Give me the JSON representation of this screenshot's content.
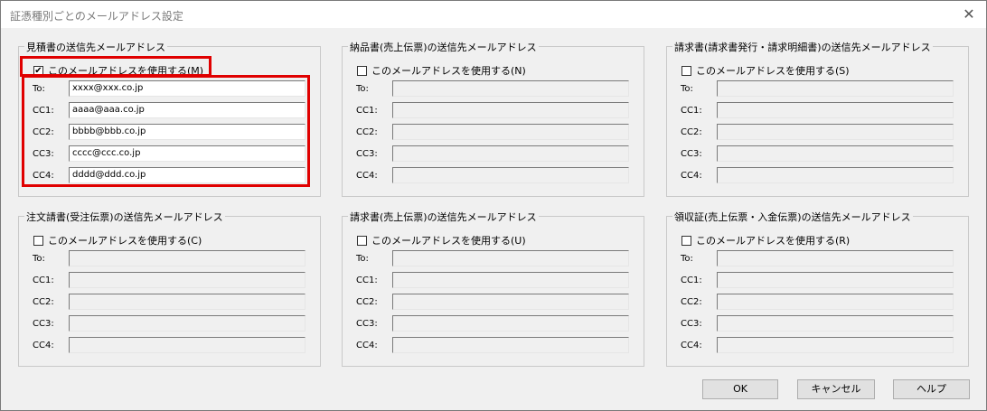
{
  "window": {
    "title": "証憑種別ごとのメールアドレス設定",
    "close_glyph": "✕"
  },
  "labels": {
    "to": "To:",
    "cc1": "CC1:",
    "cc2": "CC2:",
    "cc3": "CC3:",
    "cc4": "CC4:"
  },
  "groups": [
    {
      "title": "見積書の送信先メールアドレス",
      "checkbox_label": "このメールアドレスを使用する(M)",
      "checked": true,
      "to": "xxxx@xxx.co.jp",
      "cc1": "aaaa@aaa.co.jp",
      "cc2": "bbbb@bbb.co.jp",
      "cc3": "cccc@ccc.co.jp",
      "cc4": "dddd@ddd.co.jp"
    },
    {
      "title": "納品書(売上伝票)の送信先メールアドレス",
      "checkbox_label": "このメールアドレスを使用する(N)",
      "checked": false,
      "to": "",
      "cc1": "",
      "cc2": "",
      "cc3": "",
      "cc4": ""
    },
    {
      "title": "請求書(請求書発行・請求明細書)の送信先メールアドレス",
      "checkbox_label": "このメールアドレスを使用する(S)",
      "checked": false,
      "to": "",
      "cc1": "",
      "cc2": "",
      "cc3": "",
      "cc4": ""
    },
    {
      "title": "注文請書(受注伝票)の送信先メールアドレス",
      "checkbox_label": "このメールアドレスを使用する(C)",
      "checked": false,
      "to": "",
      "cc1": "",
      "cc2": "",
      "cc3": "",
      "cc4": ""
    },
    {
      "title": "請求書(売上伝票)の送信先メールアドレス",
      "checkbox_label": "このメールアドレスを使用する(U)",
      "checked": false,
      "to": "",
      "cc1": "",
      "cc2": "",
      "cc3": "",
      "cc4": ""
    },
    {
      "title": "領収証(売上伝票・入金伝票)の送信先メールアドレス",
      "checkbox_label": "このメールアドレスを使用する(R)",
      "checked": false,
      "to": "",
      "cc1": "",
      "cc2": "",
      "cc3": "",
      "cc4": ""
    }
  ],
  "buttons": {
    "ok": "OK",
    "cancel": "キャンセル",
    "help": "ヘルプ"
  },
  "colors": {
    "highlight": "#e00000",
    "background": "#f0f0f0"
  }
}
